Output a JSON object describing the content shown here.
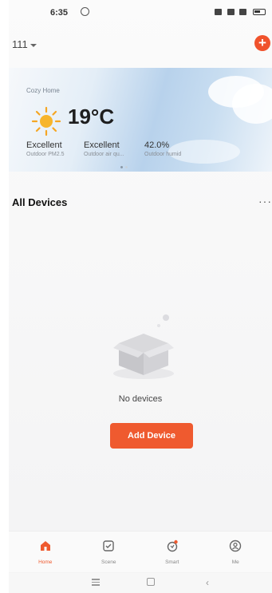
{
  "status_bar": {
    "time": "6:35"
  },
  "header": {
    "home_selector": "111",
    "add_label": "+"
  },
  "weather": {
    "home_name": "Cozy Home",
    "temperature": "19°C",
    "metrics": [
      {
        "value": "Excellent",
        "label": "Outdoor PM2.5"
      },
      {
        "value": "Excellent",
        "label": "Outdoor air qu..."
      },
      {
        "value": "42.0%",
        "label": "Outdoor humid"
      }
    ]
  },
  "devices": {
    "title": "All Devices",
    "more": "···",
    "empty_text": "No devices",
    "add_button": "Add Device"
  },
  "tabs": [
    {
      "label": "Home",
      "active": true
    },
    {
      "label": "Scene",
      "active": false
    },
    {
      "label": "Smart",
      "active": false
    },
    {
      "label": "Me",
      "active": false
    }
  ],
  "colors": {
    "accent": "#ef5a2f",
    "background": "#f6f6f7"
  },
  "icons": [
    "alarm-icon",
    "bluetooth-icon",
    "signal-icon",
    "wifi-icon",
    "battery-icon",
    "sun-icon",
    "home-icon",
    "scene-icon",
    "smart-icon",
    "me-icon"
  ]
}
